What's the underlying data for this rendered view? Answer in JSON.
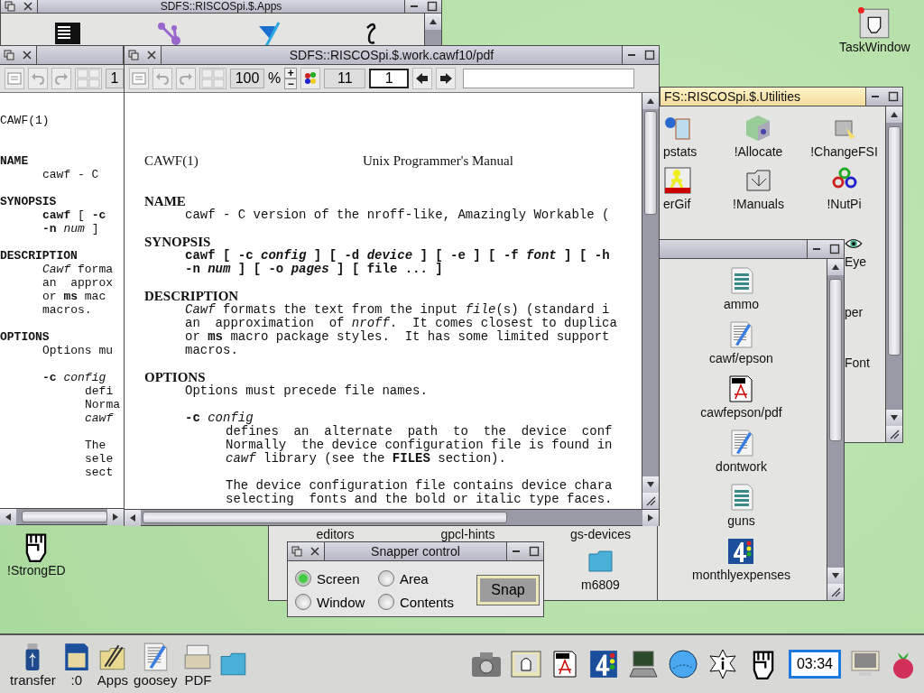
{
  "apps_window": {
    "title": "SDFS::RISCOSpi.$.Apps",
    "focused": false,
    "icons": [
      {
        "kind": "terminal"
      },
      {
        "kind": "network"
      },
      {
        "kind": "writer"
      },
      {
        "kind": "script"
      }
    ]
  },
  "back_document_window": {
    "focused": false,
    "toolbar": {
      "zoom": "1"
    },
    "header_left": "CAWF(1)",
    "sections": [
      {
        "heading": "NAME",
        "paragraphs": [
          {
            "kind": "body",
            "lines": [
              "cawf - C"
            ]
          }
        ]
      },
      {
        "heading": "SYNOPSIS",
        "paragraphs": [
          {
            "kind": "body",
            "lines": [
              "**cawf** [ **-c**",
              "**-n** *num* ]"
            ]
          }
        ]
      },
      {
        "heading": "DESCRIPTION",
        "paragraphs": [
          {
            "kind": "body",
            "lines": [
              "*Cawf* forma",
              "an  approx",
              "or **ms** mac",
              "macros."
            ]
          }
        ]
      },
      {
        "heading": "OPTIONS",
        "paragraphs": [
          {
            "kind": "body",
            "lines": [
              "Options mu"
            ]
          },
          {
            "kind": "option",
            "lines": [
              "**-c** *config*"
            ]
          },
          {
            "kind": "detail",
            "lines": [
              "defi",
              "Norma",
              "*cawf*"
            ]
          },
          {
            "kind": "detail",
            "lines": [
              "The",
              "sele",
              "sect"
            ]
          }
        ]
      }
    ]
  },
  "pdf_window": {
    "title": "SDFS::RISCOSpi.$.work.cawf10/pdf",
    "focused": false,
    "toolbar": {
      "zoom": "100",
      "zoom_unit": "%",
      "zoom_in": "+",
      "zoom_out": "−",
      "page_count": "11",
      "page": "1"
    },
    "header_left": "CAWF(1)",
    "header_center": "Unix Programmer's Manual",
    "sections": [
      {
        "heading": "NAME",
        "paragraphs": [
          {
            "kind": "body",
            "lines": [
              "cawf - C version of the nroff-like, Amazingly Workable ("
            ]
          }
        ]
      },
      {
        "heading": "SYNOPSIS",
        "paragraphs": [
          {
            "kind": "synopsis",
            "lines": [
              "cawf [ -c *config* ] [ -d *device* ] [ -e ] [ -f *font* ] [ -h",
              "-n *num* ] [ -o *pages* ] [ file ... ]"
            ]
          }
        ]
      },
      {
        "heading": "DESCRIPTION",
        "paragraphs": [
          {
            "kind": "body",
            "lines": [
              "*Cawf* formats the text from the input *file*(s) (standard i",
              "an  approximation  of *nroff*.  It comes closest to duplica",
              "or **ms** macro package styles.  It has some limited support",
              "macros."
            ]
          }
        ]
      },
      {
        "heading": "OPTIONS",
        "paragraphs": [
          {
            "kind": "body",
            "lines": [
              "Options must precede file names."
            ]
          },
          {
            "kind": "option",
            "lines": [
              "**-c** *config*"
            ]
          },
          {
            "kind": "detail",
            "lines": [
              "defines  an  alternate  path  to  the  device  conf",
              "Normally  the device configuration file is found in",
              "*cawf* library (see the **FILES** section)."
            ]
          },
          {
            "kind": "detail",
            "lines": [
              "The device configuration file contains device chara",
              "selecting  fonts and the bold or italic type faces."
            ]
          }
        ]
      }
    ]
  },
  "utilities_window": {
    "title": "FS::RISCOSpi.$.Utilities",
    "focused": true,
    "items": [
      {
        "label": "pstats",
        "kind": "window"
      },
      {
        "label": "!Allocate",
        "kind": "cube"
      },
      {
        "label": "!ChangeFSI",
        "kind": "picture"
      },
      {
        "label": "erGif",
        "kind": "person"
      },
      {
        "label": "!Manuals",
        "kind": "manual"
      },
      {
        "label": "!NutPi",
        "kind": "gears"
      }
    ],
    "side_items": [
      {
        "label": "Eye",
        "kind": "eye"
      },
      {
        "label": "per",
        "kind": "none"
      },
      {
        "label": "Font",
        "kind": "none"
      }
    ]
  },
  "work_window": {
    "focused": false,
    "items": [
      {
        "label": "ammo",
        "kind": "text"
      },
      {
        "label": "cawf/epson",
        "kind": "edit"
      },
      {
        "label": "cawfepson/pdf",
        "kind": "pdf"
      },
      {
        "label": "dontwork",
        "kind": "edit"
      },
      {
        "label": "guns",
        "kind": "text"
      },
      {
        "label": "monthlyexpenses",
        "kind": "sheet"
      }
    ]
  },
  "gs_window": {
    "items": [
      {
        "label": "editors",
        "kind": "none"
      },
      {
        "label": "gpcl-hints",
        "kind": "none"
      },
      {
        "label": "gs-devices",
        "kind": "none"
      },
      {
        "label": "m6809",
        "kind": "folder"
      }
    ]
  },
  "snapper_window": {
    "title": "Snapper control",
    "focused": false,
    "options": [
      {
        "label": "Screen",
        "selected": true
      },
      {
        "label": "Area",
        "selected": false
      },
      {
        "label": "Window",
        "selected": false
      },
      {
        "label": "Contents",
        "selected": false
      }
    ],
    "button": "Snap"
  },
  "desktop_icons": [
    {
      "label": "TaskWindow",
      "kind": "taskwindow"
    },
    {
      "label": "!StrongED",
      "kind": "fist"
    }
  ],
  "iconbar": {
    "left": [
      {
        "label": "transfer",
        "kind": "usb"
      },
      {
        "label": ":0",
        "kind": "sd"
      },
      {
        "label": "Apps",
        "kind": "apps"
      },
      {
        "label": "goosey",
        "kind": "edit"
      },
      {
        "label": "PDF",
        "kind": "printer"
      },
      {
        "kind": "folder"
      }
    ],
    "clock": "03:34"
  }
}
